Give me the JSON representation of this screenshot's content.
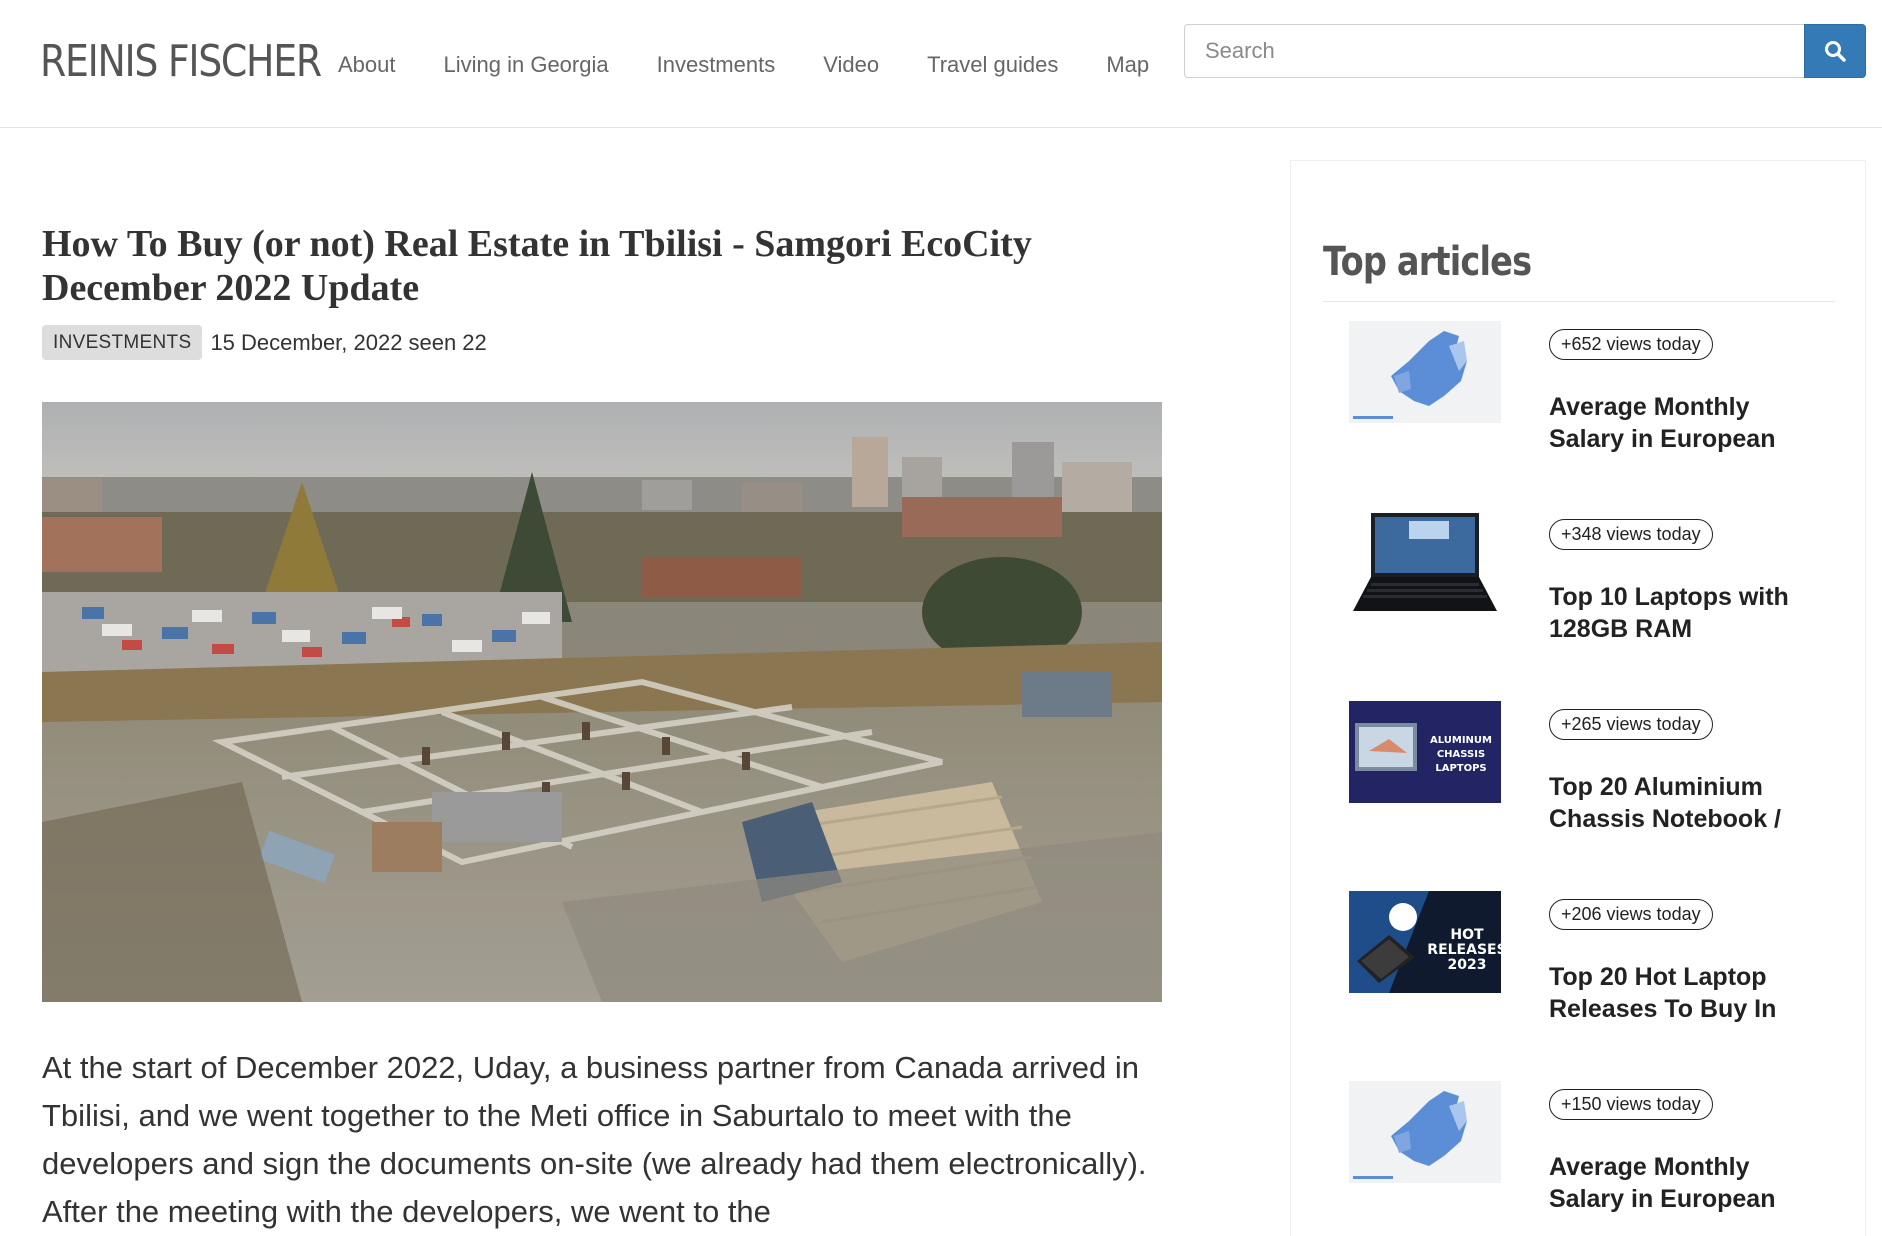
{
  "header": {
    "logo": "REINIS FISCHER",
    "nav": [
      "About",
      "Living in Georgia",
      "Investments",
      "Video",
      "Travel guides",
      "Map"
    ],
    "search_placeholder": "Search",
    "search_icon": "search-icon"
  },
  "article": {
    "title": "How To Buy (or not) Real Estate in Tbilisi - Samgori EcoCity December 2022 Update",
    "category": "INVESTMENTS",
    "date": "15 December, 2022",
    "seen": "seen 22",
    "body": "At the start of December 2022, Uday, a business partner from Canada arrived in Tbilisi, and we went together to the Meti office in Saburtalo to meet with the developers and sign the documents on-site (we already had them electronically). After the meeting with the developers, we went to the"
  },
  "sidebar": {
    "title": "Top articles",
    "items": [
      {
        "views": "+652 views today",
        "title": "Average Monthly Salary in European",
        "thumb": "europe-map"
      },
      {
        "views": "+348 views today",
        "title": "Top 10 Laptops with 128GB RAM",
        "thumb": "laptop"
      },
      {
        "views": "+265 views today",
        "title": "Top 20 Aluminium Chassis Notebook /",
        "thumb": "aluminum-laptops",
        "thumb_text": [
          "ALUMINUM",
          "CHASSIS",
          "LAPTOPS"
        ]
      },
      {
        "views": "+206 views today",
        "title": "Top 20 Hot Laptop Releases To Buy In",
        "thumb": "hot-releases",
        "thumb_text": [
          "HOT",
          "RELEASES",
          "2023"
        ]
      },
      {
        "views": "+150 views today",
        "title": "Average Monthly Salary in European",
        "thumb": "europe-map"
      }
    ]
  },
  "colors": {
    "accent": "#337ab7",
    "text": "#333333",
    "badge_bg": "#dddddd"
  }
}
